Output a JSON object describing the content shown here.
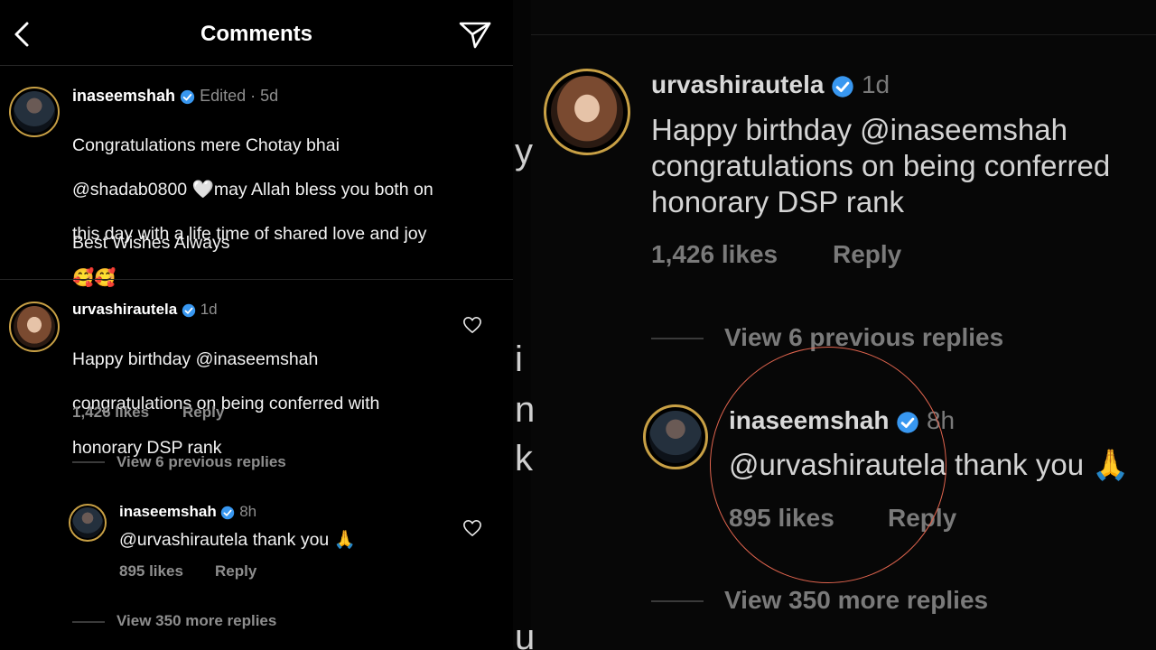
{
  "header": {
    "title": "Comments",
    "back_icon": "chevron-left-icon",
    "share_icon": "paper-plane-icon"
  },
  "colors": {
    "background": "#000000",
    "text": "#f2f2f2",
    "muted": "#8e8e8e",
    "verified": "#3897f0",
    "highlight_circle": "#e0644e"
  },
  "caption": {
    "username": "inaseemshah",
    "meta": "Edited · 5d",
    "lines": [
      "Congratulations mere Chotay bhai",
      "@shadab0800 🤍may Allah bless you both on",
      "this day with a life time of shared love and joy",
      "🥰🥰"
    ],
    "closing": "Best Wishes Always"
  },
  "comment": {
    "username": "urvashirautela",
    "time": "1d",
    "lines": [
      "Happy birthday @inaseemshah",
      "congratulations on being conferred with",
      "honorary DSP rank"
    ],
    "likes": "1,426 likes",
    "reply_label": "Reply",
    "view_previous": "View 6 previous replies"
  },
  "reply": {
    "username": "inaseemshah",
    "time": "8h",
    "text": "@urvashirautela thank you 🙏",
    "likes": "895 likes",
    "reply_label": "Reply",
    "view_more": "View 350 more replies"
  },
  "zoom": {
    "strip_chars": [
      "y",
      "i",
      "n",
      "k",
      "u"
    ],
    "comment_lines": [
      "Happy birthday @inaseemshah",
      "congratulations on being conferred",
      "honorary DSP rank"
    ],
    "reply_text": "@urvashirautela thank you 🙏"
  }
}
